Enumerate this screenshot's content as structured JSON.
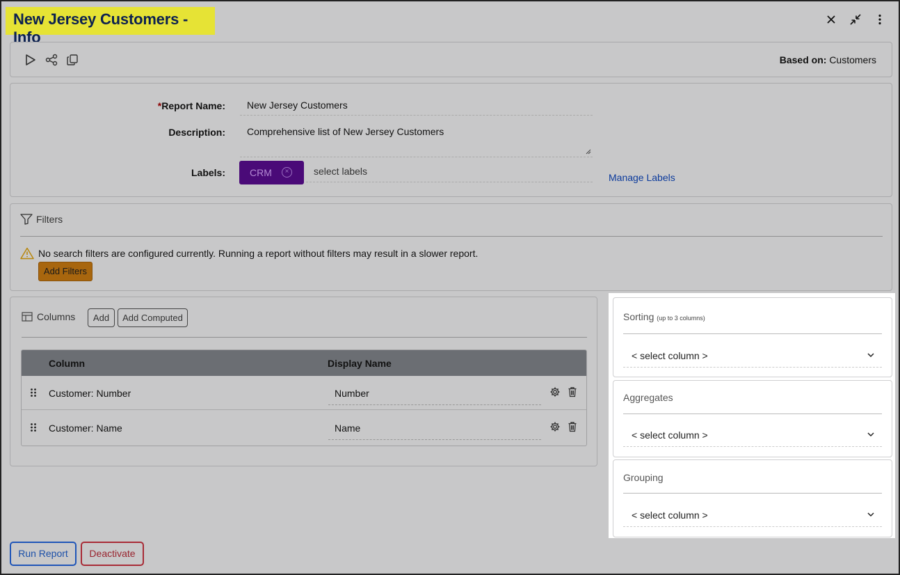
{
  "header": {
    "title": "New Jersey Customers - Info",
    "controls": [
      "close-icon",
      "minimize-icon",
      "more-vertical-icon"
    ]
  },
  "toolbar": {
    "icons": [
      "play-icon",
      "share-icon",
      "copy-icon"
    ],
    "based_on_label": "Based on:",
    "based_on_value": "Customers"
  },
  "info": {
    "report_name_required": "*",
    "report_name_label": "Report Name:",
    "report_name_value": "New Jersey Customers",
    "description_label": "Description:",
    "description_value": "Comprehensive list of New Jersey Customers",
    "labels_label": "Labels:",
    "label_chip": "CRM",
    "label_chip_color": "#4a0a78",
    "labels_placeholder": "select labels",
    "manage_labels": "Manage Labels"
  },
  "filters": {
    "title": "Filters",
    "warning": "No search filters are configured currently. Running a report without filters may result in a slower report.",
    "add_filters": "Add Filters",
    "add_filters_color": "#a8660e"
  },
  "columns": {
    "title": "Columns",
    "add": "Add",
    "add_computed": "Add Computed",
    "headers": {
      "column": "Column",
      "display_name": "Display Name"
    },
    "rows": [
      {
        "column": "Customer: Number",
        "display_name": "Number"
      },
      {
        "column": "Customer: Name",
        "display_name": "Name"
      }
    ]
  },
  "side": {
    "sorting_title": "Sorting",
    "sorting_hint": "(up to 3 columns)",
    "sorting_select": "< select column >",
    "aggregates_title": "Aggregates",
    "aggregates_select": "< select column >",
    "grouping_title": "Grouping",
    "grouping_select": "< select column >"
  },
  "footer": {
    "run_report": "Run Report",
    "deactivate": "Deactivate"
  }
}
